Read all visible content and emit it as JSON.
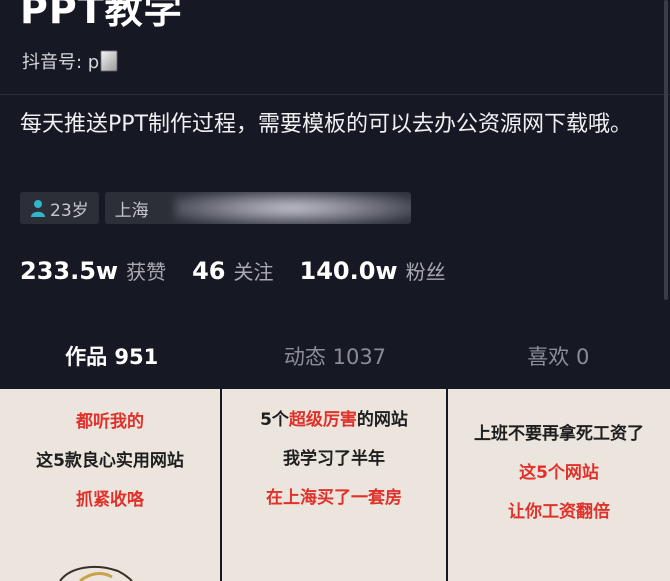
{
  "profile": {
    "name": "PPT教学",
    "account_label": "抖音号: p",
    "bio": "每天推送PPT制作过程，需要模板的可以去办公资源网下载哦。",
    "age_tag": "23岁",
    "location_tag": "上海"
  },
  "stats": [
    {
      "value": "233.5w",
      "label": "获赞"
    },
    {
      "value": "46",
      "label": "关注"
    },
    {
      "value": "140.0w",
      "label": "粉丝"
    }
  ],
  "tabs": [
    {
      "label": "作品 951",
      "active": true
    },
    {
      "label": "动态 1037",
      "active": false
    },
    {
      "label": "喜欢 0",
      "active": false
    }
  ],
  "cards": [
    {
      "lines": [
        {
          "text": "都听我的",
          "color": "red"
        },
        {
          "text": "这5款良心实用网站",
          "color": "dark"
        },
        {
          "text": "抓紧收咯",
          "color": "red"
        }
      ]
    },
    {
      "lines": [
        {
          "text": "5个超级厉害的网站",
          "color": "mixed"
        },
        {
          "text": "我学习了半年",
          "color": "dark"
        },
        {
          "text": "在上海买了一套房",
          "color": "red"
        }
      ]
    },
    {
      "lines": [
        {
          "text": "上班不要再拿死工资了",
          "color": "dark"
        },
        {
          "text": "这5个网站",
          "color": "red"
        },
        {
          "text": "让你工资翻倍",
          "color": "red"
        }
      ]
    }
  ],
  "colors": {
    "background": "#161823",
    "accent_underline": "#face15",
    "card_background": "#ebe5de",
    "card_red": "#e0312b"
  },
  "icons": {
    "age_tag": "person-icon"
  }
}
